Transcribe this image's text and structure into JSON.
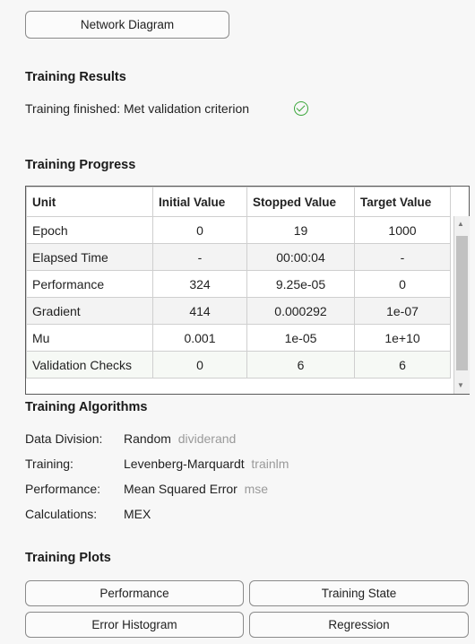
{
  "network_diagram_label": "Network Diagram",
  "results": {
    "heading": "Training Results",
    "status": "Training finished: Met validation criterion"
  },
  "progress": {
    "heading": "Training Progress",
    "columns": [
      "Unit",
      "Initial Value",
      "Stopped Value",
      "Target Value"
    ],
    "rows": [
      [
        "Epoch",
        "0",
        "19",
        "1000"
      ],
      [
        "Elapsed Time",
        "-",
        "00:00:04",
        "-"
      ],
      [
        "Performance",
        "324",
        "9.25e-05",
        "0"
      ],
      [
        "Gradient",
        "414",
        "0.000292",
        "1e-07"
      ],
      [
        "Mu",
        "0.001",
        "1e-05",
        "1e+10"
      ],
      [
        "Validation Checks",
        "0",
        "6",
        "6"
      ]
    ]
  },
  "algorithms": {
    "heading": "Training Algorithms",
    "items": [
      {
        "label": "Data Division:",
        "value": "Random",
        "fn": "dividerand"
      },
      {
        "label": "Training:",
        "value": "Levenberg-Marquardt",
        "fn": "trainlm"
      },
      {
        "label": "Performance:",
        "value": "Mean Squared Error",
        "fn": "mse"
      },
      {
        "label": "Calculations:",
        "value": "MEX",
        "fn": ""
      }
    ]
  },
  "plots": {
    "heading": "Training Plots",
    "buttons": [
      "Performance",
      "Training State",
      "Error Histogram",
      "Regression"
    ]
  },
  "colors": {
    "success": "#3aa63a",
    "secondary_text": "#9a9a9a"
  }
}
